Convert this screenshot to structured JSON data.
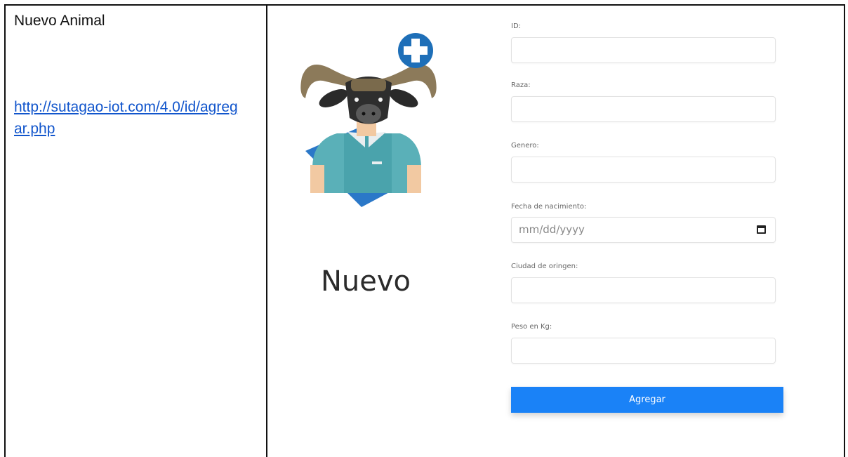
{
  "left_cell": {
    "title": "Nuevo Animal",
    "link": "http://sutagao-iot.com/4.0/id/agregar.php"
  },
  "hero": {
    "word": "Nuevo"
  },
  "icons": {
    "illustration": "buffalo-person-add-icon",
    "calendar": "calendar-icon"
  },
  "form": {
    "fields": [
      {
        "label": "ID:",
        "value": ""
      },
      {
        "label": "Raza:",
        "value": ""
      },
      {
        "label": "Genero:",
        "value": ""
      },
      {
        "label": "Fecha de nacimiento:",
        "value": "mm/dd/yyyy"
      },
      {
        "label": "Ciudad de oringen:",
        "value": ""
      },
      {
        "label": "Peso en Kg:",
        "value": ""
      }
    ],
    "submit_label": "Agregar"
  },
  "colors": {
    "accent": "#1a82f7",
    "link": "#1155cc"
  }
}
